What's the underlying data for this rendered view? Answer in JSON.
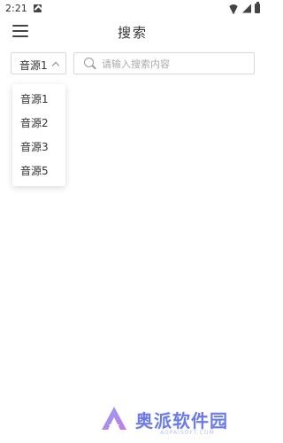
{
  "status_bar": {
    "time": "2:21"
  },
  "header": {
    "title": "搜索"
  },
  "source_select": {
    "selected": "音源1",
    "options": [
      "音源1",
      "音源2",
      "音源3",
      "音源5"
    ]
  },
  "search": {
    "placeholder": "请输入搜索内容",
    "value": ""
  },
  "watermark": {
    "brand": "奥派软件园",
    "subtitle": "AOPAISOFT.COM"
  },
  "colors": {
    "watermark": "#6b7be8",
    "border": "#d9d9d9"
  }
}
